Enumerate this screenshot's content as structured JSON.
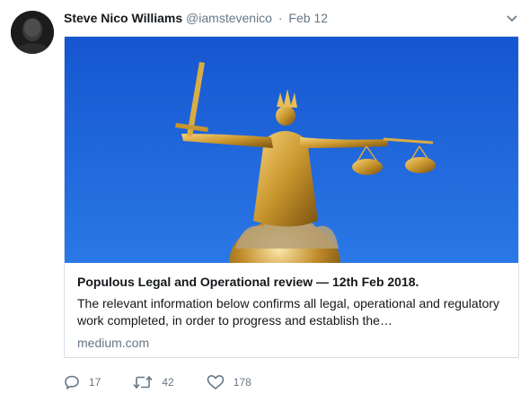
{
  "tweet": {
    "author_name": "Steve Nico Williams",
    "handle": "@iamstevenico",
    "separator": "·",
    "timestamp": "Feb 12",
    "card": {
      "title": "Populous Legal and Operational review — 12th Feb 2018.",
      "description": "The relevant information below confirms all legal, operational and regulatory work completed, in order to progress and establish the…",
      "domain": "medium.com"
    },
    "actions": {
      "replies": "17",
      "retweets": "42",
      "likes": "178"
    }
  },
  "colors": {
    "secondary_text": "#657786",
    "border": "#d6dee4",
    "sky": "#1a63d8"
  },
  "icons": [
    "avatar",
    "chevron-down-icon",
    "reply-icon",
    "retweet-icon",
    "like-icon"
  ]
}
